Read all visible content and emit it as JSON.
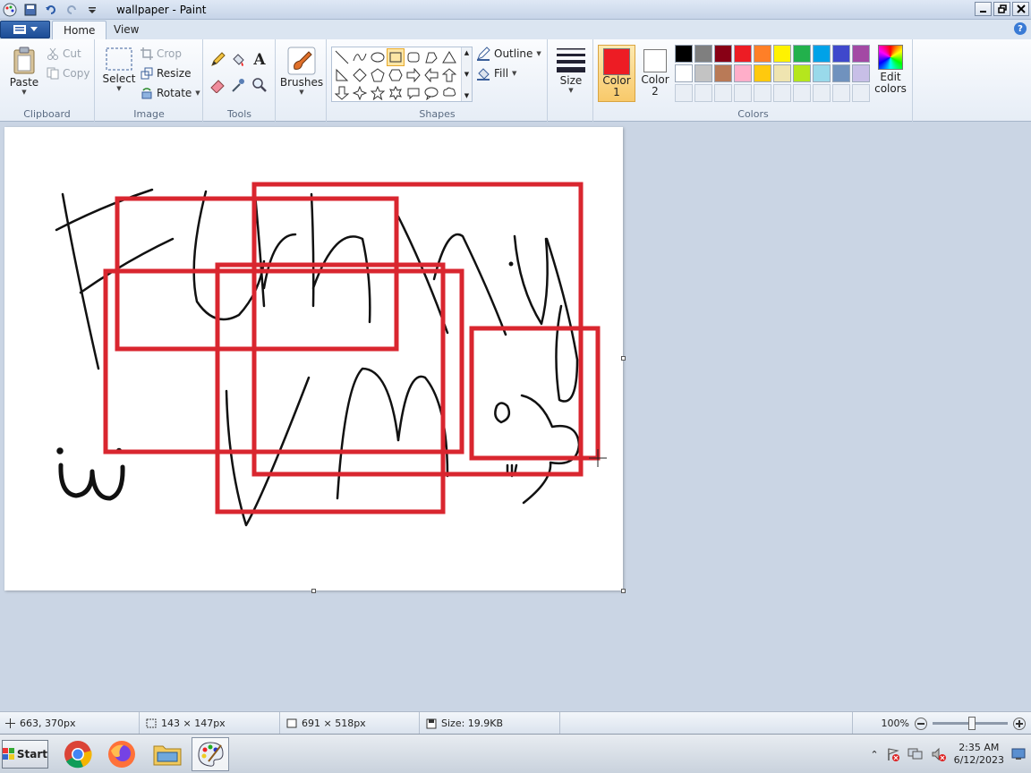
{
  "window": {
    "title": "wallpaper - Paint"
  },
  "tabs": [
    {
      "label": "Home"
    },
    {
      "label": "View"
    }
  ],
  "help_label": "?",
  "clipboard": {
    "paste": "Paste",
    "cut": "Cut",
    "copy": "Copy",
    "group": "Clipboard"
  },
  "image": {
    "select": "Select",
    "crop": "Crop",
    "resize": "Resize",
    "rotate": "Rotate",
    "group": "Image"
  },
  "tools": {
    "group": "Tools",
    "text_tool_glyph": "A"
  },
  "brushes": {
    "label": "Brushes"
  },
  "shapes": {
    "outline": "Outline",
    "fill": "Fill",
    "group": "Shapes"
  },
  "size": {
    "label": "Size"
  },
  "colors": {
    "color1_label": "Color",
    "color1_num": "1",
    "color2_label": "Color",
    "color2_num": "2",
    "edit_label": "Edit",
    "edit_label2": "colors",
    "group": "Colors",
    "color1": "#ed1c24",
    "color2": "#ffffff",
    "palette_row1": [
      "#000000",
      "#7f7f7f",
      "#880015",
      "#ed1c24",
      "#ff7f27",
      "#fff200",
      "#22b14c",
      "#00a2e8",
      "#3f48cc",
      "#a349a4"
    ],
    "palette_row2": [
      "#ffffff",
      "#c3c3c3",
      "#b97a57",
      "#ffaec9",
      "#ffc90e",
      "#efe4b0",
      "#b5e61d",
      "#99d9ea",
      "#7092be",
      "#c8bfe7"
    ]
  },
  "status": {
    "cursor": "663, 370px",
    "selection": "143 × 147px",
    "canvas": "691 × 518px",
    "size": "Size: 19.9KB",
    "zoom": "100%"
  },
  "taskbar": {
    "start": "Start",
    "time": "2:35 AM",
    "date": "6/12/2023"
  },
  "accent_stroke": "#d9262f"
}
